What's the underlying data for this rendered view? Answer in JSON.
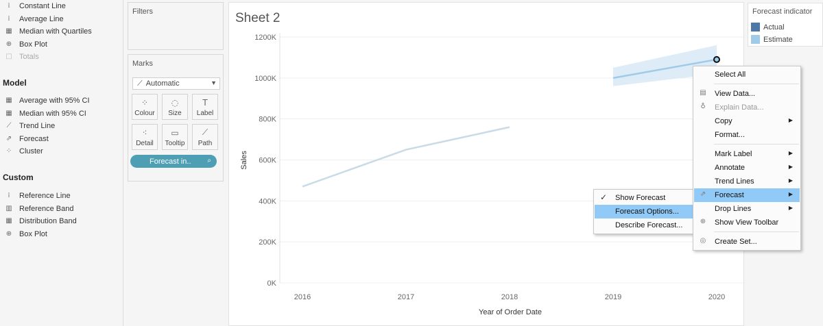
{
  "analytics": {
    "summarise_items": [
      {
        "label": "Constant Line",
        "icon": "constant-line-icon",
        "glyph": "⁞",
        "disabled": false
      },
      {
        "label": "Average Line",
        "icon": "average-line-icon",
        "glyph": "⁞",
        "disabled": false
      },
      {
        "label": "Median with Quartiles",
        "icon": "median-quartiles-icon",
        "glyph": "▦",
        "disabled": false
      },
      {
        "label": "Box Plot",
        "icon": "box-plot-icon",
        "glyph": "⊕",
        "disabled": false
      },
      {
        "label": "Totals",
        "icon": "totals-icon",
        "glyph": "□",
        "disabled": true
      }
    ],
    "model_heading": "Model",
    "model_items": [
      {
        "label": "Average with 95% CI",
        "icon": "average-ci-icon",
        "glyph": "▦"
      },
      {
        "label": "Median with 95% CI",
        "icon": "median-ci-icon",
        "glyph": "▦"
      },
      {
        "label": "Trend Line",
        "icon": "trend-line-icon",
        "glyph": "⟋"
      },
      {
        "label": "Forecast",
        "icon": "forecast-icon",
        "glyph": "⇗"
      },
      {
        "label": "Cluster",
        "icon": "cluster-icon",
        "glyph": "⁘"
      }
    ],
    "custom_heading": "Custom",
    "custom_items": [
      {
        "label": "Reference Line",
        "icon": "reference-line-icon",
        "glyph": "⁞"
      },
      {
        "label": "Reference Band",
        "icon": "reference-band-icon",
        "glyph": "▥"
      },
      {
        "label": "Distribution Band",
        "icon": "distribution-band-icon",
        "glyph": "▦"
      },
      {
        "label": "Box Plot",
        "icon": "box-plot-icon",
        "glyph": "⊕"
      }
    ]
  },
  "shelves": {
    "filters_title": "Filters",
    "marks_title": "Marks",
    "mark_type": "Automatic",
    "mark_buttons": [
      {
        "label": "Colour",
        "icon": "colour-icon",
        "glyph": "⁘"
      },
      {
        "label": "Size",
        "icon": "size-icon",
        "glyph": "◌"
      },
      {
        "label": "Label",
        "icon": "label-icon",
        "glyph": "T"
      },
      {
        "label": "Detail",
        "icon": "detail-icon",
        "glyph": "⁖"
      },
      {
        "label": "Tooltip",
        "icon": "tooltip-icon",
        "glyph": "▭"
      },
      {
        "label": "Path",
        "icon": "path-icon",
        "glyph": "⟋"
      }
    ],
    "pill_label": "Forecast in.."
  },
  "sheet": {
    "title": "Sheet 2"
  },
  "legend": {
    "title": "Forecast indicator",
    "items": [
      {
        "label": "Actual",
        "color": "#4e79a7"
      },
      {
        "label": "Estimate",
        "color": "#a0cbe8"
      }
    ]
  },
  "context_menu": {
    "items": [
      {
        "label": "Select All",
        "icon": "",
        "submenu": false,
        "disabled": false,
        "highlight": false
      },
      {
        "sep": true
      },
      {
        "label": "View Data...",
        "icon": "view-data-icon",
        "glyph": "▤",
        "submenu": false,
        "disabled": false,
        "highlight": false
      },
      {
        "label": "Explain Data...",
        "icon": "explain-data-icon",
        "glyph": "♁",
        "submenu": false,
        "disabled": true,
        "highlight": false
      },
      {
        "label": "Copy",
        "icon": "",
        "submenu": true,
        "disabled": false,
        "highlight": false
      },
      {
        "label": "Format...",
        "icon": "",
        "submenu": false,
        "disabled": false,
        "highlight": false
      },
      {
        "sep": true
      },
      {
        "label": "Mark Label",
        "icon": "",
        "submenu": true,
        "disabled": false,
        "highlight": false
      },
      {
        "label": "Annotate",
        "icon": "",
        "submenu": true,
        "disabled": false,
        "highlight": false
      },
      {
        "label": "Trend Lines",
        "icon": "",
        "submenu": true,
        "disabled": false,
        "highlight": false
      },
      {
        "label": "Forecast",
        "icon": "forecast-icon",
        "glyph": "⇗",
        "submenu": true,
        "disabled": false,
        "highlight": true
      },
      {
        "label": "Drop Lines",
        "icon": "",
        "submenu": true,
        "disabled": false,
        "highlight": false
      },
      {
        "label": "Show View Toolbar",
        "icon": "zoom-icon",
        "glyph": "⊕",
        "submenu": false,
        "disabled": false,
        "highlight": false
      },
      {
        "sep": true
      },
      {
        "label": "Create Set...",
        "icon": "create-set-icon",
        "glyph": "◎",
        "submenu": false,
        "disabled": false,
        "highlight": false
      }
    ]
  },
  "forecast_submenu": {
    "items": [
      {
        "label": "Show Forecast",
        "checked": true,
        "highlight": false
      },
      {
        "label": "Forecast Options...",
        "checked": false,
        "highlight": true
      },
      {
        "label": "Describe Forecast...",
        "checked": false,
        "highlight": false
      }
    ]
  },
  "chart_data": {
    "type": "line",
    "xlabel": "Year of Order Date",
    "ylabel": "Sales",
    "categories": [
      "2016",
      "2017",
      "2018",
      "2019",
      "2020"
    ],
    "ylim": [
      0,
      1200000
    ],
    "y_ticks": [
      "0K",
      "200K",
      "400K",
      "600K",
      "800K",
      "1000K",
      "1200K"
    ],
    "series": [
      {
        "name": "Actual",
        "x": [
          "2016",
          "2017",
          "2018"
        ],
        "values": [
          470000,
          650000,
          760000
        ],
        "color": "#c9dbe6"
      },
      {
        "name": "Estimate",
        "x": [
          "2019",
          "2020"
        ],
        "values": [
          1000000,
          1090000
        ],
        "upper": [
          1050000,
          1160000
        ],
        "lower": [
          960000,
          1020000
        ],
        "color": "#a0cbe8"
      }
    ],
    "selected_point": {
      "x": "2020",
      "y": 1090000
    },
    "grid": "horizontal"
  }
}
